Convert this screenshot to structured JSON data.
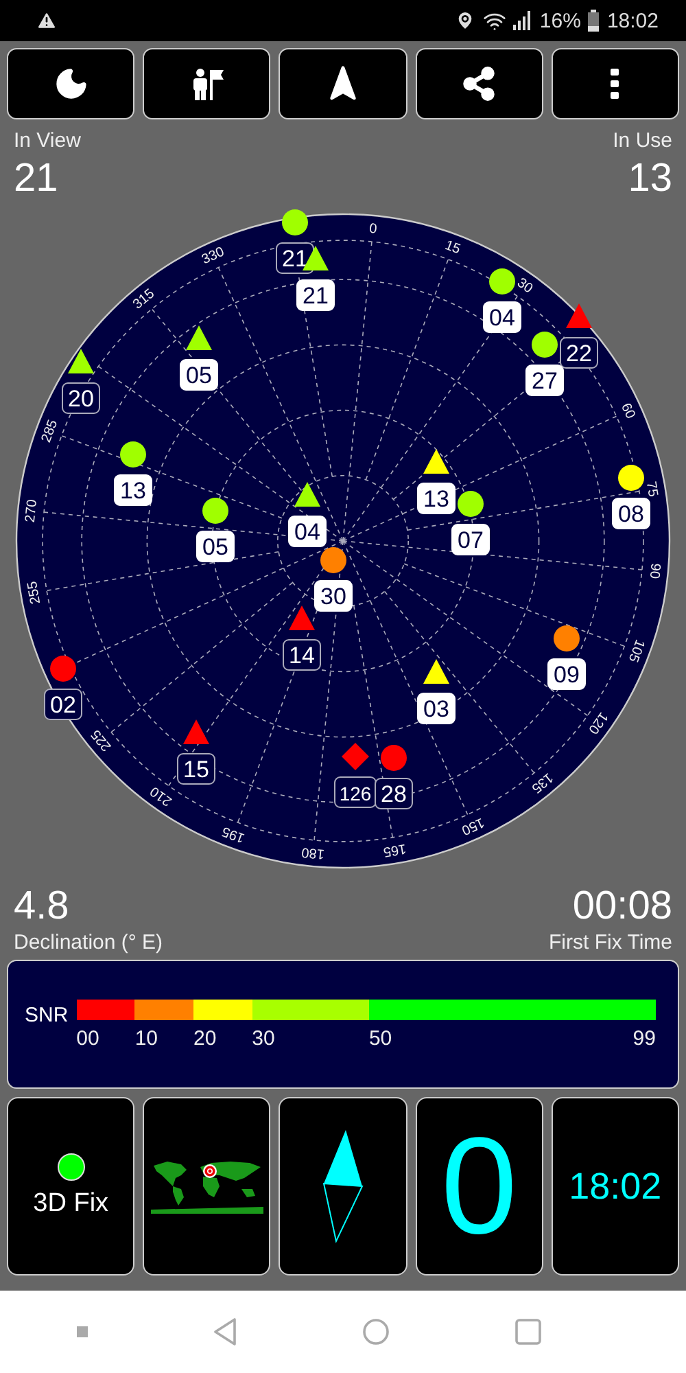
{
  "status_bar": {
    "battery": "16%",
    "time": "18:02"
  },
  "in_view": {
    "label": "In View",
    "value": "21"
  },
  "in_use": {
    "label": "In Use",
    "value": "13"
  },
  "sky_plot": {
    "azimuth_labels": [
      "0",
      "15",
      "30",
      "60",
      "75",
      "90",
      "105",
      "120",
      "135",
      "150",
      "165",
      "180",
      "195",
      "210",
      "225",
      "255",
      "270",
      "285",
      "315",
      "330"
    ],
    "satellites": [
      {
        "prn": "21",
        "kind": "circle",
        "color": "#a0ff00",
        "in_use": false
      },
      {
        "prn": "21",
        "kind": "triangle",
        "color": "#a0ff00",
        "in_use": true
      },
      {
        "prn": "04",
        "kind": "circle",
        "color": "#a0ff00",
        "in_use": true
      },
      {
        "prn": "22",
        "kind": "triangle",
        "color": "#ff0000",
        "in_use": false
      },
      {
        "prn": "27",
        "kind": "circle",
        "color": "#a0ff00",
        "in_use": true
      },
      {
        "prn": "05",
        "kind": "triangle",
        "color": "#a0ff00",
        "in_use": true
      },
      {
        "prn": "20",
        "kind": "triangle",
        "color": "#a0ff00",
        "in_use": false
      },
      {
        "prn": "13",
        "kind": "circle",
        "color": "#a0ff00",
        "in_use": true
      },
      {
        "prn": "13",
        "kind": "triangle",
        "color": "#ffff00",
        "in_use": true
      },
      {
        "prn": "07",
        "kind": "circle",
        "color": "#a0ff00",
        "in_use": true
      },
      {
        "prn": "08",
        "kind": "circle",
        "color": "#ffff00",
        "in_use": true
      },
      {
        "prn": "05",
        "kind": "circle",
        "color": "#a0ff00",
        "in_use": true
      },
      {
        "prn": "04",
        "kind": "triangle",
        "color": "#a0ff00",
        "in_use": true
      },
      {
        "prn": "30",
        "kind": "circle",
        "color": "#ff8000",
        "in_use": true
      },
      {
        "prn": "14",
        "kind": "triangle",
        "color": "#ff0000",
        "in_use": false
      },
      {
        "prn": "09",
        "kind": "circle",
        "color": "#ff8000",
        "in_use": true
      },
      {
        "prn": "02",
        "kind": "circle",
        "color": "#ff0000",
        "in_use": false
      },
      {
        "prn": "03",
        "kind": "triangle",
        "color": "#ffff00",
        "in_use": true
      },
      {
        "prn": "15",
        "kind": "triangle",
        "color": "#ff0000",
        "in_use": false
      },
      {
        "prn": "126",
        "kind": "diamond",
        "color": "#ff0000",
        "in_use": false
      },
      {
        "prn": "28",
        "kind": "circle",
        "color": "#ff0000",
        "in_use": false
      }
    ]
  },
  "declination": {
    "value": "4.8",
    "label": "Declination (° E)"
  },
  "first_fix": {
    "value": "00:08",
    "label": "First Fix Time"
  },
  "snr": {
    "label": "SNR",
    "segments": [
      {
        "tick": "00",
        "color": "#ff0000"
      },
      {
        "tick": "10",
        "color": "#ff8000"
      },
      {
        "tick": "20",
        "color": "#ffff00"
      },
      {
        "tick": "30",
        "color": "#a8ff00"
      },
      {
        "tick": "50",
        "color": "#00ff00"
      }
    ],
    "end_tick": "99"
  },
  "tiles": [
    {
      "kind": "fix",
      "label": "3D Fix",
      "color": "#00ff00"
    },
    {
      "kind": "map"
    },
    {
      "kind": "compass"
    },
    {
      "kind": "speed",
      "value": "0"
    },
    {
      "kind": "clock",
      "value": "18:02"
    }
  ]
}
